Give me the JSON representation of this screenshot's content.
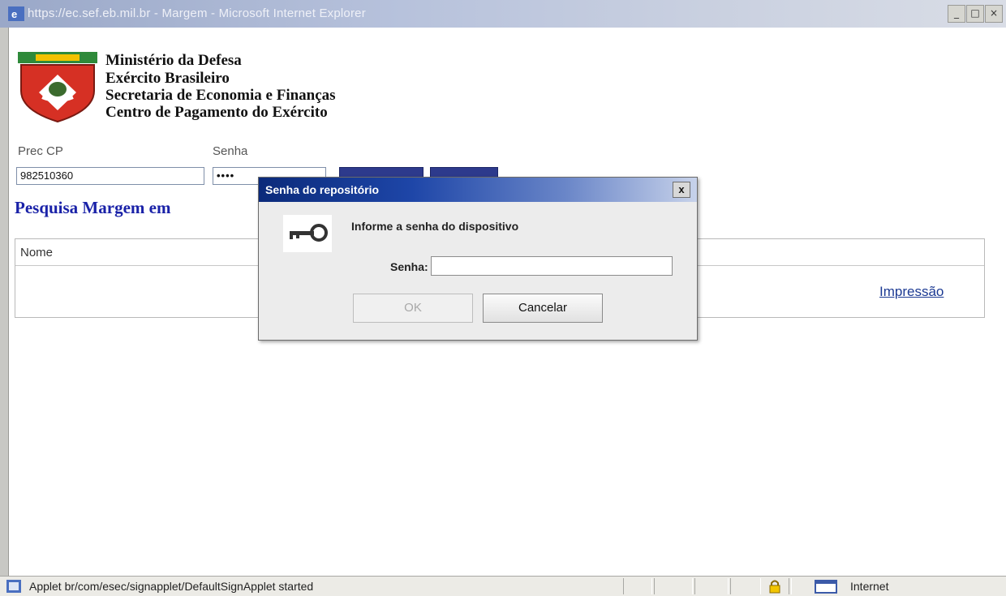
{
  "window": {
    "title": "https://ec.sef.eb.mil.br - Margem - Microsoft Internet Explorer",
    "minimize": "_",
    "maximize": "□",
    "close": "×"
  },
  "header": {
    "lines": [
      "Ministério da Defesa",
      "Exército Brasileiro",
      "Secretaria de Economia e Finanças",
      "Centro de Pagamento do Exército"
    ]
  },
  "form": {
    "prec_label": "Prec CP",
    "prec_value": "982510360",
    "senha_label": "Senha",
    "senha_value": "••••"
  },
  "page": {
    "heading": "Pesquisa Margem em",
    "table_col_name": "Nome",
    "print_link": "Impressão"
  },
  "dialog": {
    "title": "Senha do repositório",
    "close": "x",
    "icon": "key-icon",
    "message": "Informe a senha do dispositivo",
    "password_label": "Senha:",
    "password_value": "",
    "ok": "OK",
    "cancel": "Cancelar"
  },
  "status": {
    "text": "Applet br/com/esec/signapplet/DefaultSignApplet started",
    "zone": "Internet"
  },
  "colors": {
    "heading": "#1a22a8",
    "dialog_title": "#0b2a7a",
    "nav_button": "#2d3a8c"
  }
}
